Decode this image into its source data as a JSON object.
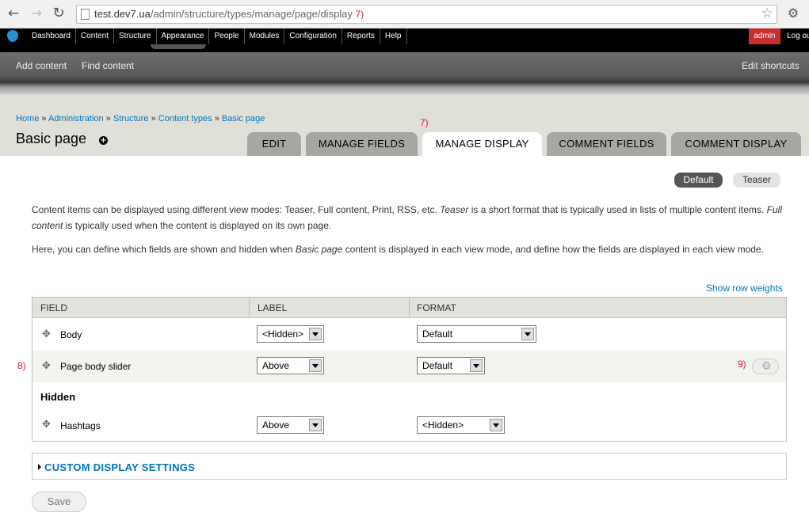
{
  "browser": {
    "url_host": "test.dev7.ua",
    "url_path": "/admin/structure/types/manage/page/display",
    "url_note": "7)"
  },
  "toolbar": {
    "menu": [
      "Dashboard",
      "Content",
      "Structure",
      "Appearance",
      "People",
      "Modules",
      "Configuration",
      "Reports",
      "Help"
    ],
    "user": "admin",
    "logout": "Log out"
  },
  "shortcuts": {
    "add_content": "Add content",
    "find_content": "Find content",
    "edit_shortcuts": "Edit shortcuts"
  },
  "breadcrumb": [
    "Home",
    "Administration",
    "Structure",
    "Content types",
    "Basic page"
  ],
  "breadcrumb_sep": " » ",
  "page_title": "Basic page",
  "add_shortcut_symbol": "+",
  "tabs_note": "7)",
  "primary_tabs": [
    "EDIT",
    "MANAGE FIELDS",
    "MANAGE DISPLAY",
    "COMMENT FIELDS",
    "COMMENT DISPLAY"
  ],
  "secondary_tabs": [
    "Default",
    "Teaser"
  ],
  "description": {
    "p1_a": "Content items can be displayed using different view modes: Teaser, Full content, Print, RSS, etc. ",
    "p1_em1": "Teaser",
    "p1_b": " is a short format that is typically used in lists of multiple content items. ",
    "p1_em2": "Full content",
    "p1_c": " is typically used when the content is displayed on its own page.",
    "p2_a": "Here, you can define which fields are shown and hidden when ",
    "p2_em": "Basic page",
    "p2_b": " content is displayed in each view mode, and define how the fields are displayed in each view mode."
  },
  "show_row_weights": "Show row weights",
  "table": {
    "headers": [
      "FIELD",
      "LABEL",
      "FORMAT"
    ],
    "rows": [
      {
        "field": "Body",
        "label": "<Hidden>",
        "format": "Default"
      },
      {
        "field": "Page body slider",
        "label": "Above",
        "format": "Default"
      },
      {
        "field": "Hashtags",
        "label": "Above",
        "format": "<Hidden>"
      }
    ],
    "hidden_region": "Hidden"
  },
  "notes": {
    "row_note": "8)",
    "gear_note": "9)"
  },
  "custom_display_settings": "CUSTOM DISPLAY SETTINGS",
  "save": "Save",
  "colors": {
    "link": "#0074bd",
    "admin_badge": "#c92f2f",
    "note": "#e02020",
    "tab_inactive": "#a6a7a2",
    "header_bg": "#e0e0d8"
  }
}
